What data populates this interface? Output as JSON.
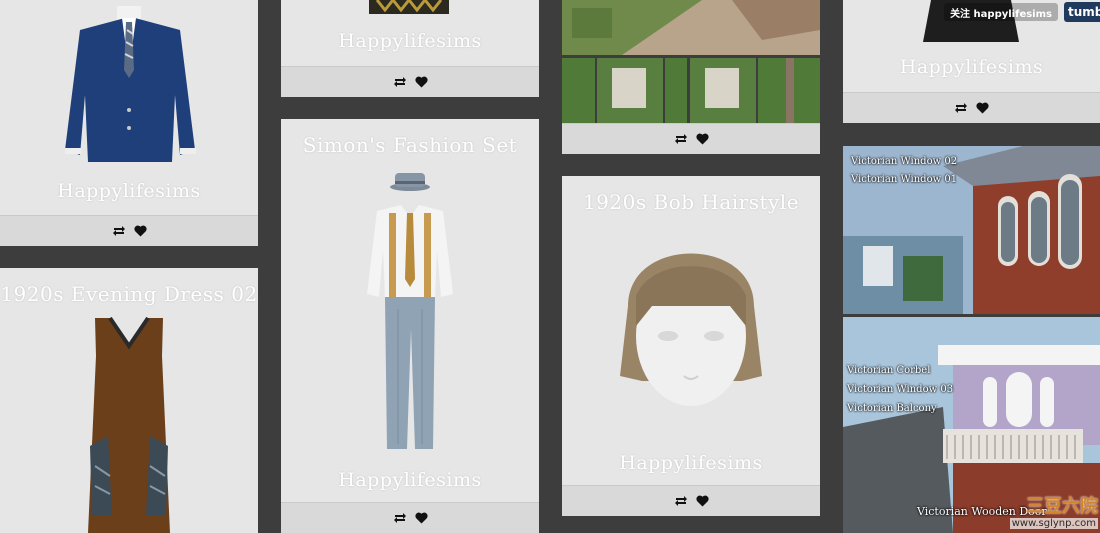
{
  "posts": {
    "c1_top": {
      "caption": "Happylifesims"
    },
    "c1_dress": {
      "title": "1920s Evening Dress 02"
    },
    "c2_top": {
      "caption": "Happylifesims"
    },
    "c2_set": {
      "title": "Simon's Fashion Set",
      "caption": "Happylifesims"
    },
    "c3_hair": {
      "title": "1920s Bob Hairstyle",
      "caption": "Happylifesims"
    },
    "c4_top": {
      "caption": "Happylifesims"
    },
    "c4_victorian": {
      "labels_top": [
        "Victorian Window 02",
        "Victorian Window 01"
      ],
      "labels_bottom": [
        "Victorian Corbel",
        "Victorian Window 03",
        "Victorian Balcony"
      ],
      "door_label": "Victorian Wooden Door"
    }
  },
  "actions": {
    "reblog": "reblog-icon",
    "like": "heart-icon"
  },
  "header": {
    "follow_label": "关注 happylifesims",
    "tumblr_label": "tumb"
  },
  "watermark": {
    "chinese": "三豆六院",
    "url": "www.sglynp.com"
  }
}
